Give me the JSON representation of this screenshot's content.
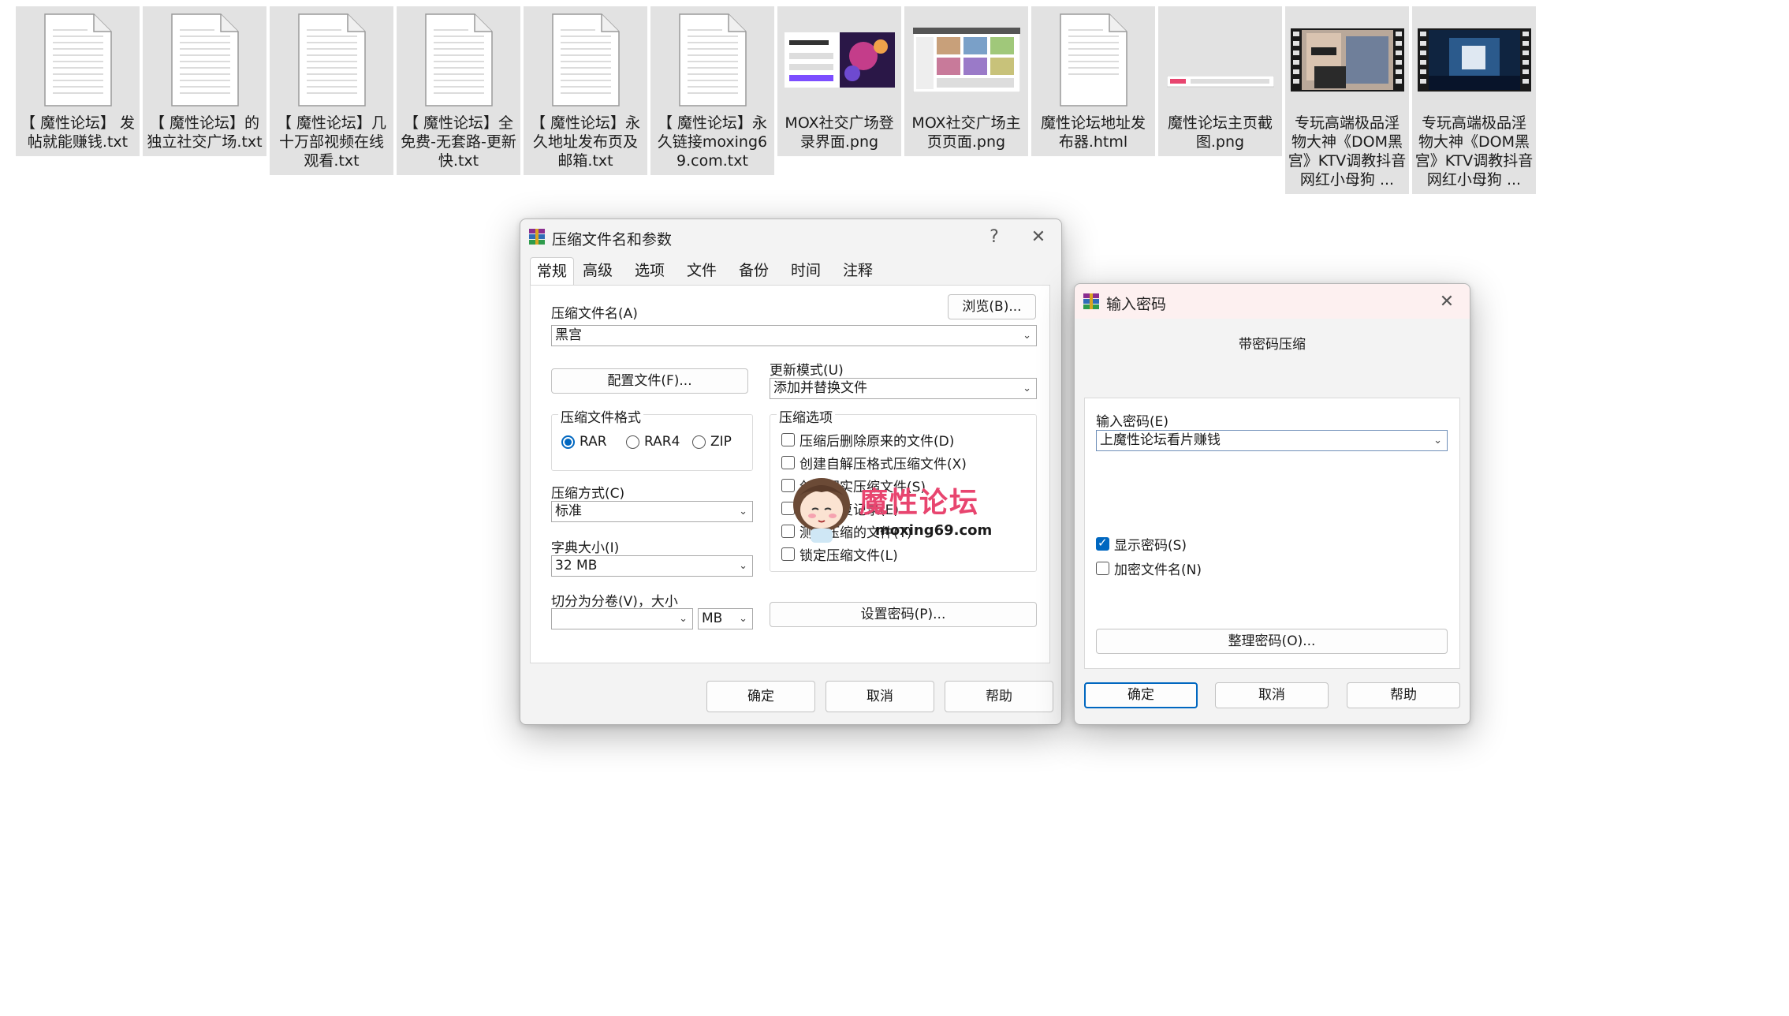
{
  "files": [
    {
      "name": "【 魔性论坛】 发帖就能赚钱.txt",
      "icon": "text-file-icon"
    },
    {
      "name": "【 魔性论坛】的独立社交广场.txt",
      "icon": "text-file-icon"
    },
    {
      "name": "【 魔性论坛】几十万部视频在线观看.txt",
      "icon": "text-file-icon"
    },
    {
      "name": "【 魔性论坛】全免费-无套路-更新快.txt",
      "icon": "text-file-icon"
    },
    {
      "name": "【 魔性论坛】永久地址发布页及邮箱.txt",
      "icon": "text-file-icon"
    },
    {
      "name": "【 魔性论坛】永久链接moxing69.com.txt",
      "icon": "text-file-icon"
    },
    {
      "name": "MOX社交广场登录界面.png",
      "icon": "image-thumbnail"
    },
    {
      "name": "MOX社交广场主页页面.png",
      "icon": "image-thumbnail"
    },
    {
      "name": "魔性论坛地址发布器.html",
      "icon": "html-file-icon"
    },
    {
      "name": "魔性论坛主页截图.png",
      "icon": "image-thumbnail"
    },
    {
      "name": "专玩高端极品淫物大神《DOM黑宫》KTV调教抖音网红小母狗 ...",
      "icon": "video-thumbnail"
    },
    {
      "name": "专玩高端极品淫物大神《DOM黑宫》KTV调教抖音网红小母狗 ...",
      "icon": "video-thumbnail"
    }
  ],
  "archive_dialog": {
    "title": "压缩文件名和参数",
    "help_glyph": "?",
    "close_glyph": "✕",
    "tabs": [
      "常规",
      "高级",
      "选项",
      "文件",
      "备份",
      "时间",
      "注释"
    ],
    "archive_name_label": "压缩文件名(A)",
    "browse_label": "浏览(B)...",
    "archive_name_value": "黑宫",
    "profiles_label": "配置文件(F)...",
    "update_mode_label": "更新模式(U)",
    "update_mode_value": "添加并替换文件",
    "format_group_title": "压缩文件格式",
    "formats": [
      "RAR",
      "RAR4",
      "ZIP"
    ],
    "method_label": "压缩方式(C)",
    "method_value": "标准",
    "dict_label": "字典大小(I)",
    "dict_value": "32 MB",
    "split_label": "切分为分卷(V)，大小",
    "split_value": "",
    "split_unit": "MB",
    "options_group_title": "压缩选项",
    "options": [
      {
        "label": "压缩后删除原来的文件(D)",
        "checked": false
      },
      {
        "label": "创建自解压格式压缩文件(X)",
        "checked": false
      },
      {
        "label": "创建固实压缩文件(S)",
        "checked": false
      },
      {
        "label": "添加恢复记录(E)",
        "checked": false
      },
      {
        "label": "测试压缩的文件(T)",
        "checked": false
      },
      {
        "label": "锁定压缩文件(L)",
        "checked": false
      }
    ],
    "set_password_label": "设置密码(P)...",
    "ok_label": "确定",
    "cancel_label": "取消",
    "help_label": "帮助"
  },
  "password_dialog": {
    "title": "输入密码",
    "close_glyph": "✕",
    "subtitle": "带密码压缩",
    "enter_label": "输入密码(E)",
    "password_value": "上魔性论坛看片赚钱",
    "show_password_label": "显示密码(S)",
    "show_password_checked": true,
    "encrypt_names_label": "加密文件名(N)",
    "encrypt_names_checked": false,
    "organize_label": "整理密码(O)...",
    "ok_label": "确定",
    "cancel_label": "取消",
    "help_label": "帮助"
  },
  "watermark": {
    "text": "魔性论坛",
    "url": "moxing69.com"
  },
  "colors": {
    "accent": "#0067c0",
    "tile_bg": "#e2e2e2",
    "watermark_pink": "#e8456f"
  }
}
